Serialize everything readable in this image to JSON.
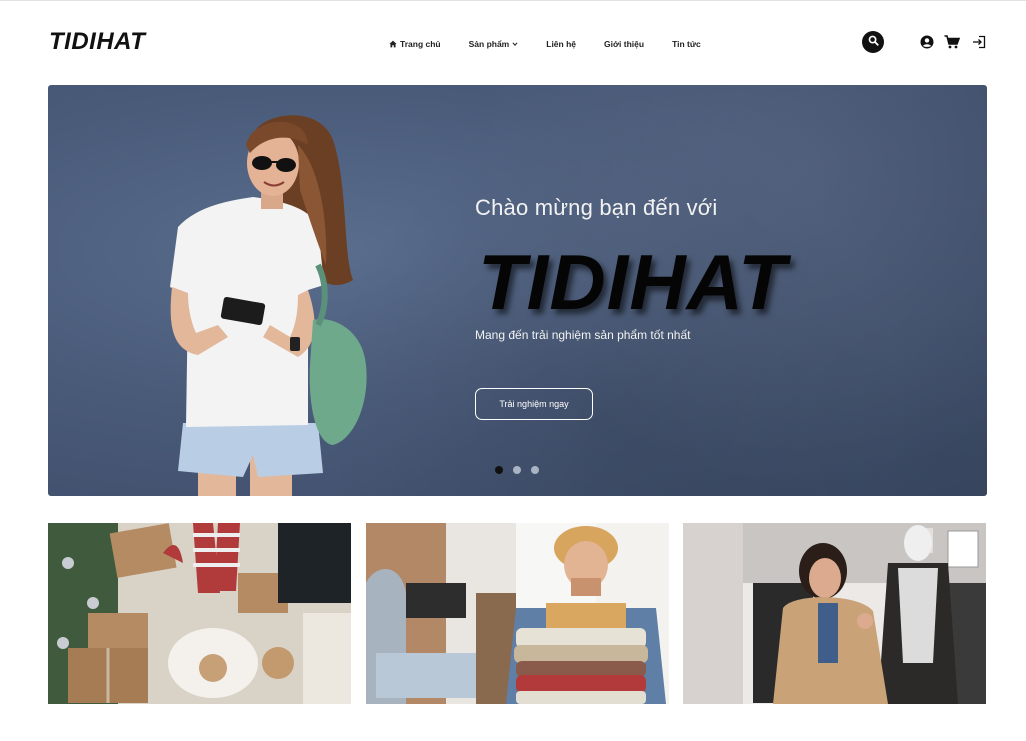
{
  "header": {
    "logo": "TIDIHAT",
    "nav": [
      {
        "label": "Trang chủ",
        "icon": "home-icon"
      },
      {
        "label": "Sản phẩm",
        "icon": "chevron-down-icon"
      },
      {
        "label": "Liên hệ"
      },
      {
        "label": "Giới thiệu"
      },
      {
        "label": "Tin tức"
      }
    ],
    "actions": [
      "search-icon",
      "user-icon",
      "cart-icon",
      "login-icon"
    ]
  },
  "hero": {
    "greeting": "Chào mừng bạn đến với",
    "brand": "TIDIHAT",
    "subtitle": "Mang đến trải nghiệm sản phẩm tốt nhất",
    "cta": "Trải nghiệm ngay",
    "slides": 3,
    "active_slide": 1
  },
  "tiles": [
    {
      "name": "christmas-gifts-photo"
    },
    {
      "name": "clothing-stack-photo"
    },
    {
      "name": "shopping-coat-photo"
    }
  ],
  "colors": {
    "hero_bg": "#4a5b7a",
    "text_dark": "#111111",
    "white": "#ffffff"
  }
}
